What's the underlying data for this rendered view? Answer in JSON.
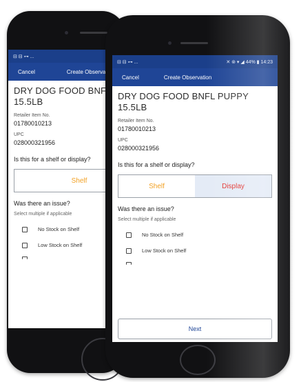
{
  "back_screen": {
    "status_icons": "⊟ ⊟ ⊶ ...",
    "cancel": "Cancel",
    "title": "Create Observation",
    "product": "DRY DOG FOOD BNFL PUPPY",
    "size": "15.5LB",
    "retailer_label": "Retailer Item No.",
    "retailer_value": "01780010213",
    "upc_label": "UPC",
    "upc_value": "028000321956",
    "question": "Is this for a shelf or display?",
    "shelf": "Shelf",
    "issue_question": "Was there an issue?",
    "hint": "Select multiple if applicable",
    "options": [
      "No Stock on Shelf",
      "Low Stock on Shelf"
    ]
  },
  "front_screen": {
    "status_left": "⊟ ⊟ ⊶ ...",
    "status_right": "✕ ⊚ ▾ ◢ 44% ▮ 14:23",
    "cancel": "Cancel",
    "title": "Create Observation",
    "product": "DRY DOG FOOD BNFL PUPPY",
    "size": "15.5LB",
    "retailer_label": "Retailer Item No.",
    "retailer_value": "01780010213",
    "upc_label": "UPC",
    "upc_value": "028000321956",
    "question": "Is this for a shelf or display?",
    "shelf": "Shelf",
    "display": "Display",
    "selected": "Display",
    "issue_question": "Was there an issue?",
    "hint": "Select multiple if applicable",
    "options": [
      "No Stock on Shelf",
      "Low Stock on Shelf"
    ],
    "next": "Next"
  },
  "colors": {
    "appbar": "#1f4596",
    "shelf_text": "#f2a124",
    "display_text": "#e3342f",
    "selected_bg": "#e4ebf6"
  }
}
